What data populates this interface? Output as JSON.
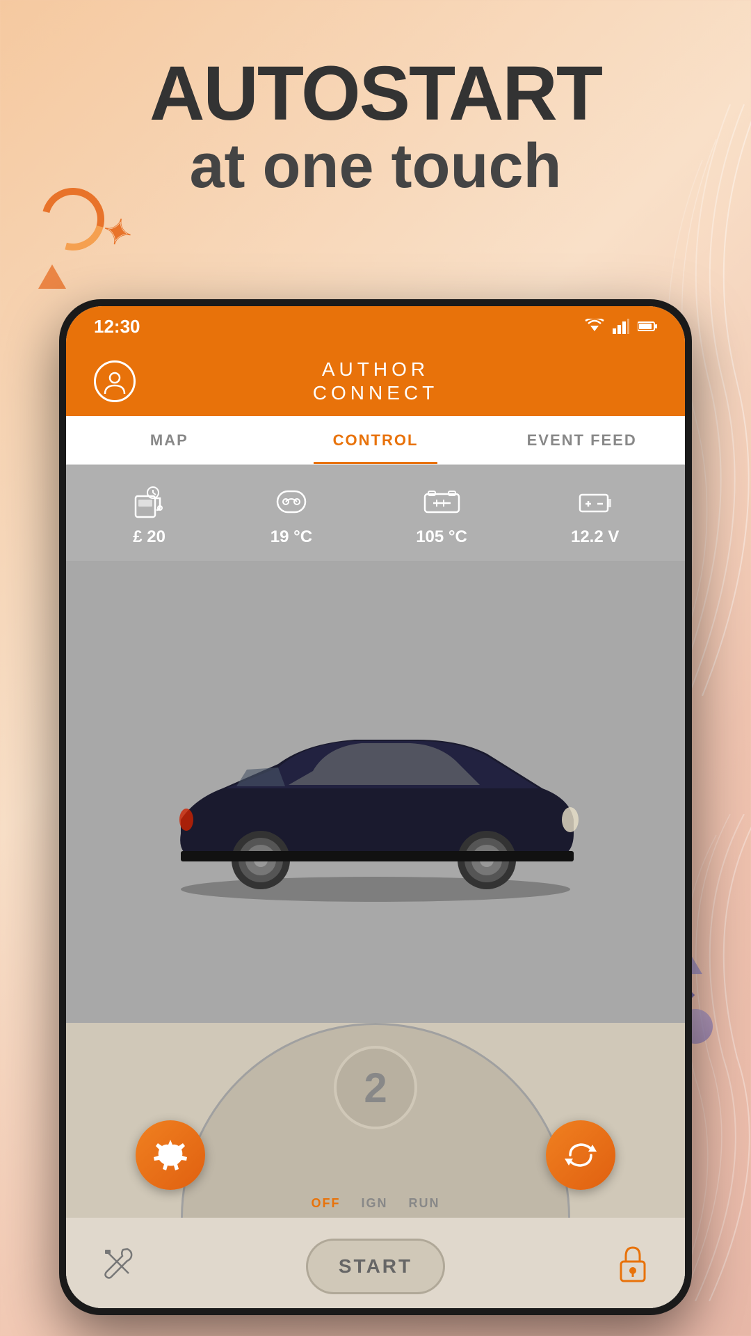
{
  "background": {
    "color_start": "#f5c9a0",
    "color_end": "#e8b8a8"
  },
  "headline": {
    "line1": "AUTOSTART",
    "line2": "at one touch"
  },
  "status_bar": {
    "time": "12:30",
    "wifi": "▼",
    "signal": "▲",
    "battery": "▮"
  },
  "app_header": {
    "logo_line1": "author",
    "logo_line2": "connect",
    "profile_icon": "person-circle"
  },
  "nav_tabs": [
    {
      "label": "MAP",
      "active": false
    },
    {
      "label": "CONTROL",
      "active": true
    },
    {
      "label": "EVENT FEED",
      "active": false
    }
  ],
  "stats": [
    {
      "icon": "fuel",
      "value": "£ 20",
      "label": "fuel-stat"
    },
    {
      "icon": "temp-outside",
      "value": "19 °C",
      "label": "outside-temp"
    },
    {
      "icon": "temp-engine",
      "value": "105 °C",
      "label": "engine-temp"
    },
    {
      "icon": "battery",
      "value": "12.2 V",
      "label": "battery-voltage"
    }
  ],
  "control_panel": {
    "dial_number": "2",
    "gear_button_icon": "gear",
    "refresh_button_icon": "refresh",
    "ignition_labels": [
      "OFF",
      "IGN",
      "RUN"
    ],
    "start_label": "START"
  },
  "bottom_toolbar": {
    "left_icon": "tools",
    "right_icon": "lock",
    "center_button": "START"
  }
}
